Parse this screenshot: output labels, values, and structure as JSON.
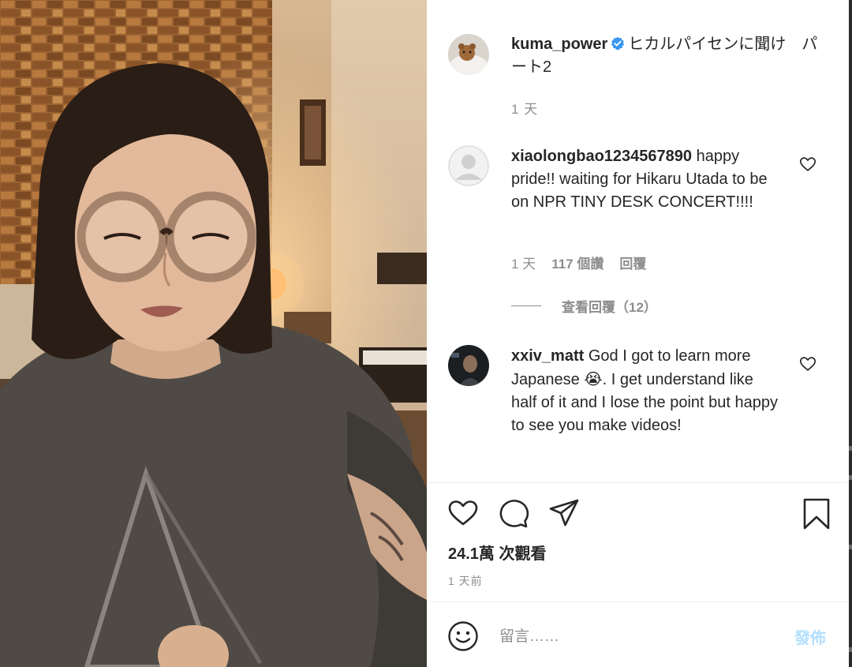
{
  "post": {
    "author": "kuma_power",
    "caption": "ヒカルパイセンに聞け　パート2",
    "age": "1 天"
  },
  "comments": [
    {
      "author": "xiaolongbao1234567890",
      "text": "happy pride!! waiting for Hikaru Utada to be on NPR TINY DESK CONCERT!!!!",
      "age": "1 天",
      "likes": "117 個讚",
      "reply_label": "回覆",
      "view_replies": "查看回覆（12）"
    },
    {
      "author": "xxiv_matt",
      "text_before_emoji": "God I got to learn more Japanese ",
      "emoji": "😭",
      "text_after_emoji": ". I get understand like half of it and I lose the point but happy to see you make videos!"
    }
  ],
  "stats": {
    "views": "24.1萬 次觀看",
    "posted": "1 天前"
  },
  "composer": {
    "placeholder": "留言……",
    "post_label": "發佈"
  },
  "icons": {
    "like": "heart-icon",
    "comment": "speech-bubble-icon",
    "share": "paper-plane-icon",
    "save": "bookmark-icon",
    "emoji": "smiley-icon",
    "verified": "verified-badge-icon"
  },
  "colors": {
    "verified_blue": "#3897f0",
    "post_button_disabled": "#b2dffc",
    "secondary_text": "#8e8e8e"
  }
}
